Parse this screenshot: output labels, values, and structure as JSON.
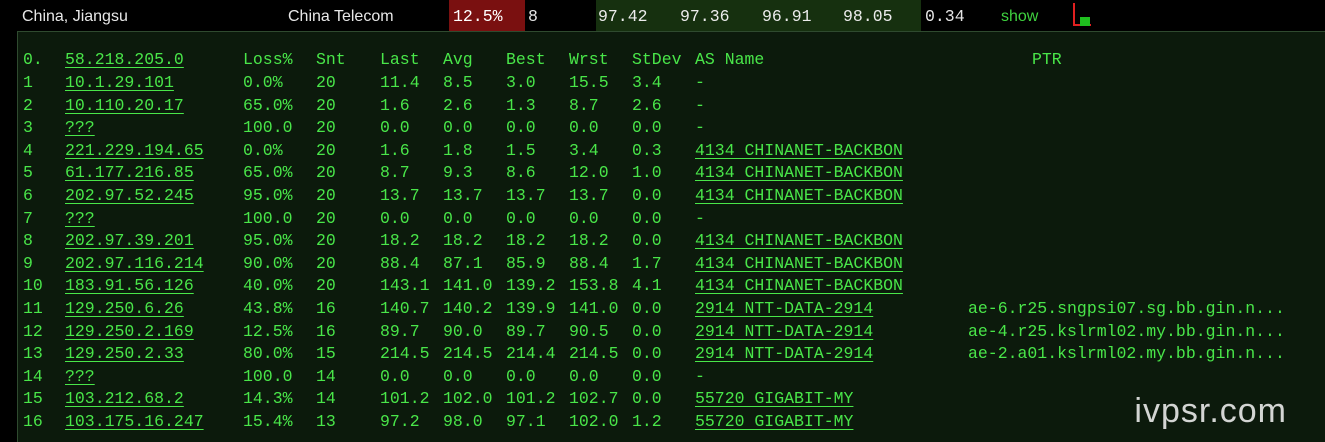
{
  "summary": {
    "location": "China, Jiangsu",
    "isp": "China Telecom",
    "loss": "12.5%",
    "sent": "8",
    "last": "97.42",
    "avg": "97.36",
    "best": "96.91",
    "worst": "98.05",
    "stdev": "0.34",
    "show_label": "show",
    "colors": {
      "loss_bg": "#7a1010",
      "stats_bg": "#16300f",
      "link": "#3fd23f"
    }
  },
  "table": {
    "columns": {
      "idx": "0.",
      "host": "58.218.205.0",
      "loss": "Loss%",
      "snt": "Snt",
      "last": "Last",
      "avg": "Avg",
      "best": "Best",
      "wrst": "Wrst",
      "stdev": "StDev",
      "as": "AS Name",
      "ptr": "PTR"
    },
    "rows": [
      {
        "idx": "1",
        "host": "10.1.29.101",
        "loss": "0.0%",
        "snt": "20",
        "last": "11.4",
        "avg": "8.5",
        "best": "3.0",
        "wrst": "15.5",
        "stdev": "3.4",
        "as": "-",
        "ptr": ""
      },
      {
        "idx": "2",
        "host": "10.110.20.17",
        "loss": "65.0%",
        "snt": "20",
        "last": "1.6",
        "avg": "2.6",
        "best": "1.3",
        "wrst": "8.7",
        "stdev": "2.6",
        "as": "-",
        "ptr": ""
      },
      {
        "idx": "3",
        "host": "???",
        "loss": "100.0",
        "snt": "20",
        "last": "0.0",
        "avg": "0.0",
        "best": "0.0",
        "wrst": "0.0",
        "stdev": "0.0",
        "as": "-",
        "ptr": ""
      },
      {
        "idx": "4",
        "host": "221.229.194.65",
        "loss": "0.0%",
        "snt": "20",
        "last": "1.6",
        "avg": "1.8",
        "best": "1.5",
        "wrst": "3.4",
        "stdev": "0.3",
        "as": "4134  CHINANET-BACKBON",
        "ptr": ""
      },
      {
        "idx": "5",
        "host": "61.177.216.85",
        "loss": "65.0%",
        "snt": "20",
        "last": "8.7",
        "avg": "9.3",
        "best": "8.6",
        "wrst": "12.0",
        "stdev": "1.0",
        "as": "4134  CHINANET-BACKBON",
        "ptr": ""
      },
      {
        "idx": "6",
        "host": "202.97.52.245",
        "loss": "95.0%",
        "snt": "20",
        "last": "13.7",
        "avg": "13.7",
        "best": "13.7",
        "wrst": "13.7",
        "stdev": "0.0",
        "as": "4134  CHINANET-BACKBON",
        "ptr": ""
      },
      {
        "idx": "7",
        "host": "???",
        "loss": "100.0",
        "snt": "20",
        "last": "0.0",
        "avg": "0.0",
        "best": "0.0",
        "wrst": "0.0",
        "stdev": "0.0",
        "as": "-",
        "ptr": ""
      },
      {
        "idx": "8",
        "host": "202.97.39.201",
        "loss": "95.0%",
        "snt": "20",
        "last": "18.2",
        "avg": "18.2",
        "best": "18.2",
        "wrst": "18.2",
        "stdev": "0.0",
        "as": "4134  CHINANET-BACKBON",
        "ptr": ""
      },
      {
        "idx": "9",
        "host": "202.97.116.214",
        "loss": "90.0%",
        "snt": "20",
        "last": "88.4",
        "avg": "87.1",
        "best": "85.9",
        "wrst": "88.4",
        "stdev": "1.7",
        "as": "4134  CHINANET-BACKBON",
        "ptr": ""
      },
      {
        "idx": "10",
        "host": "183.91.56.126",
        "loss": "40.0%",
        "snt": "20",
        "last": "143.1",
        "avg": "141.0",
        "best": "139.2",
        "wrst": "153.8",
        "stdev": "4.1",
        "as": "4134  CHINANET-BACKBON",
        "ptr": ""
      },
      {
        "idx": "11",
        "host": "129.250.6.26",
        "loss": "43.8%",
        "snt": "16",
        "last": "140.7",
        "avg": "140.2",
        "best": "139.9",
        "wrst": "141.0",
        "stdev": "0.0",
        "as": "2914  NTT-DATA-2914",
        "ptr": "ae-6.r25.sngpsi07.sg.bb.gin.n..."
      },
      {
        "idx": "12",
        "host": "129.250.2.169",
        "loss": "12.5%",
        "snt": "16",
        "last": "89.7",
        "avg": "90.0",
        "best": "89.7",
        "wrst": "90.5",
        "stdev": "0.0",
        "as": "2914  NTT-DATA-2914",
        "ptr": "ae-4.r25.kslrml02.my.bb.gin.n..."
      },
      {
        "idx": "13",
        "host": "129.250.2.33",
        "loss": "80.0%",
        "snt": "15",
        "last": "214.5",
        "avg": "214.5",
        "best": "214.4",
        "wrst": "214.5",
        "stdev": "0.0",
        "as": "2914  NTT-DATA-2914",
        "ptr": "ae-2.a01.kslrml02.my.bb.gin.n..."
      },
      {
        "idx": "14",
        "host": "???",
        "loss": "100.0",
        "snt": "14",
        "last": "0.0",
        "avg": "0.0",
        "best": "0.0",
        "wrst": "0.0",
        "stdev": "0.0",
        "as": "-",
        "ptr": ""
      },
      {
        "idx": "15",
        "host": "103.212.68.2",
        "loss": "14.3%",
        "snt": "14",
        "last": "101.2",
        "avg": "102.0",
        "best": "101.2",
        "wrst": "102.7",
        "stdev": "0.0",
        "as": "55720 GIGABIT-MY",
        "ptr": ""
      },
      {
        "idx": "16",
        "host": "103.175.16.247",
        "loss": "15.4%",
        "snt": "13",
        "last": "97.2",
        "avg": "98.0",
        "best": "97.1",
        "wrst": "102.0",
        "stdev": "1.2",
        "as": "55720 GIGABIT-MY",
        "ptr": ""
      }
    ]
  },
  "watermark": "ivpsr.com"
}
